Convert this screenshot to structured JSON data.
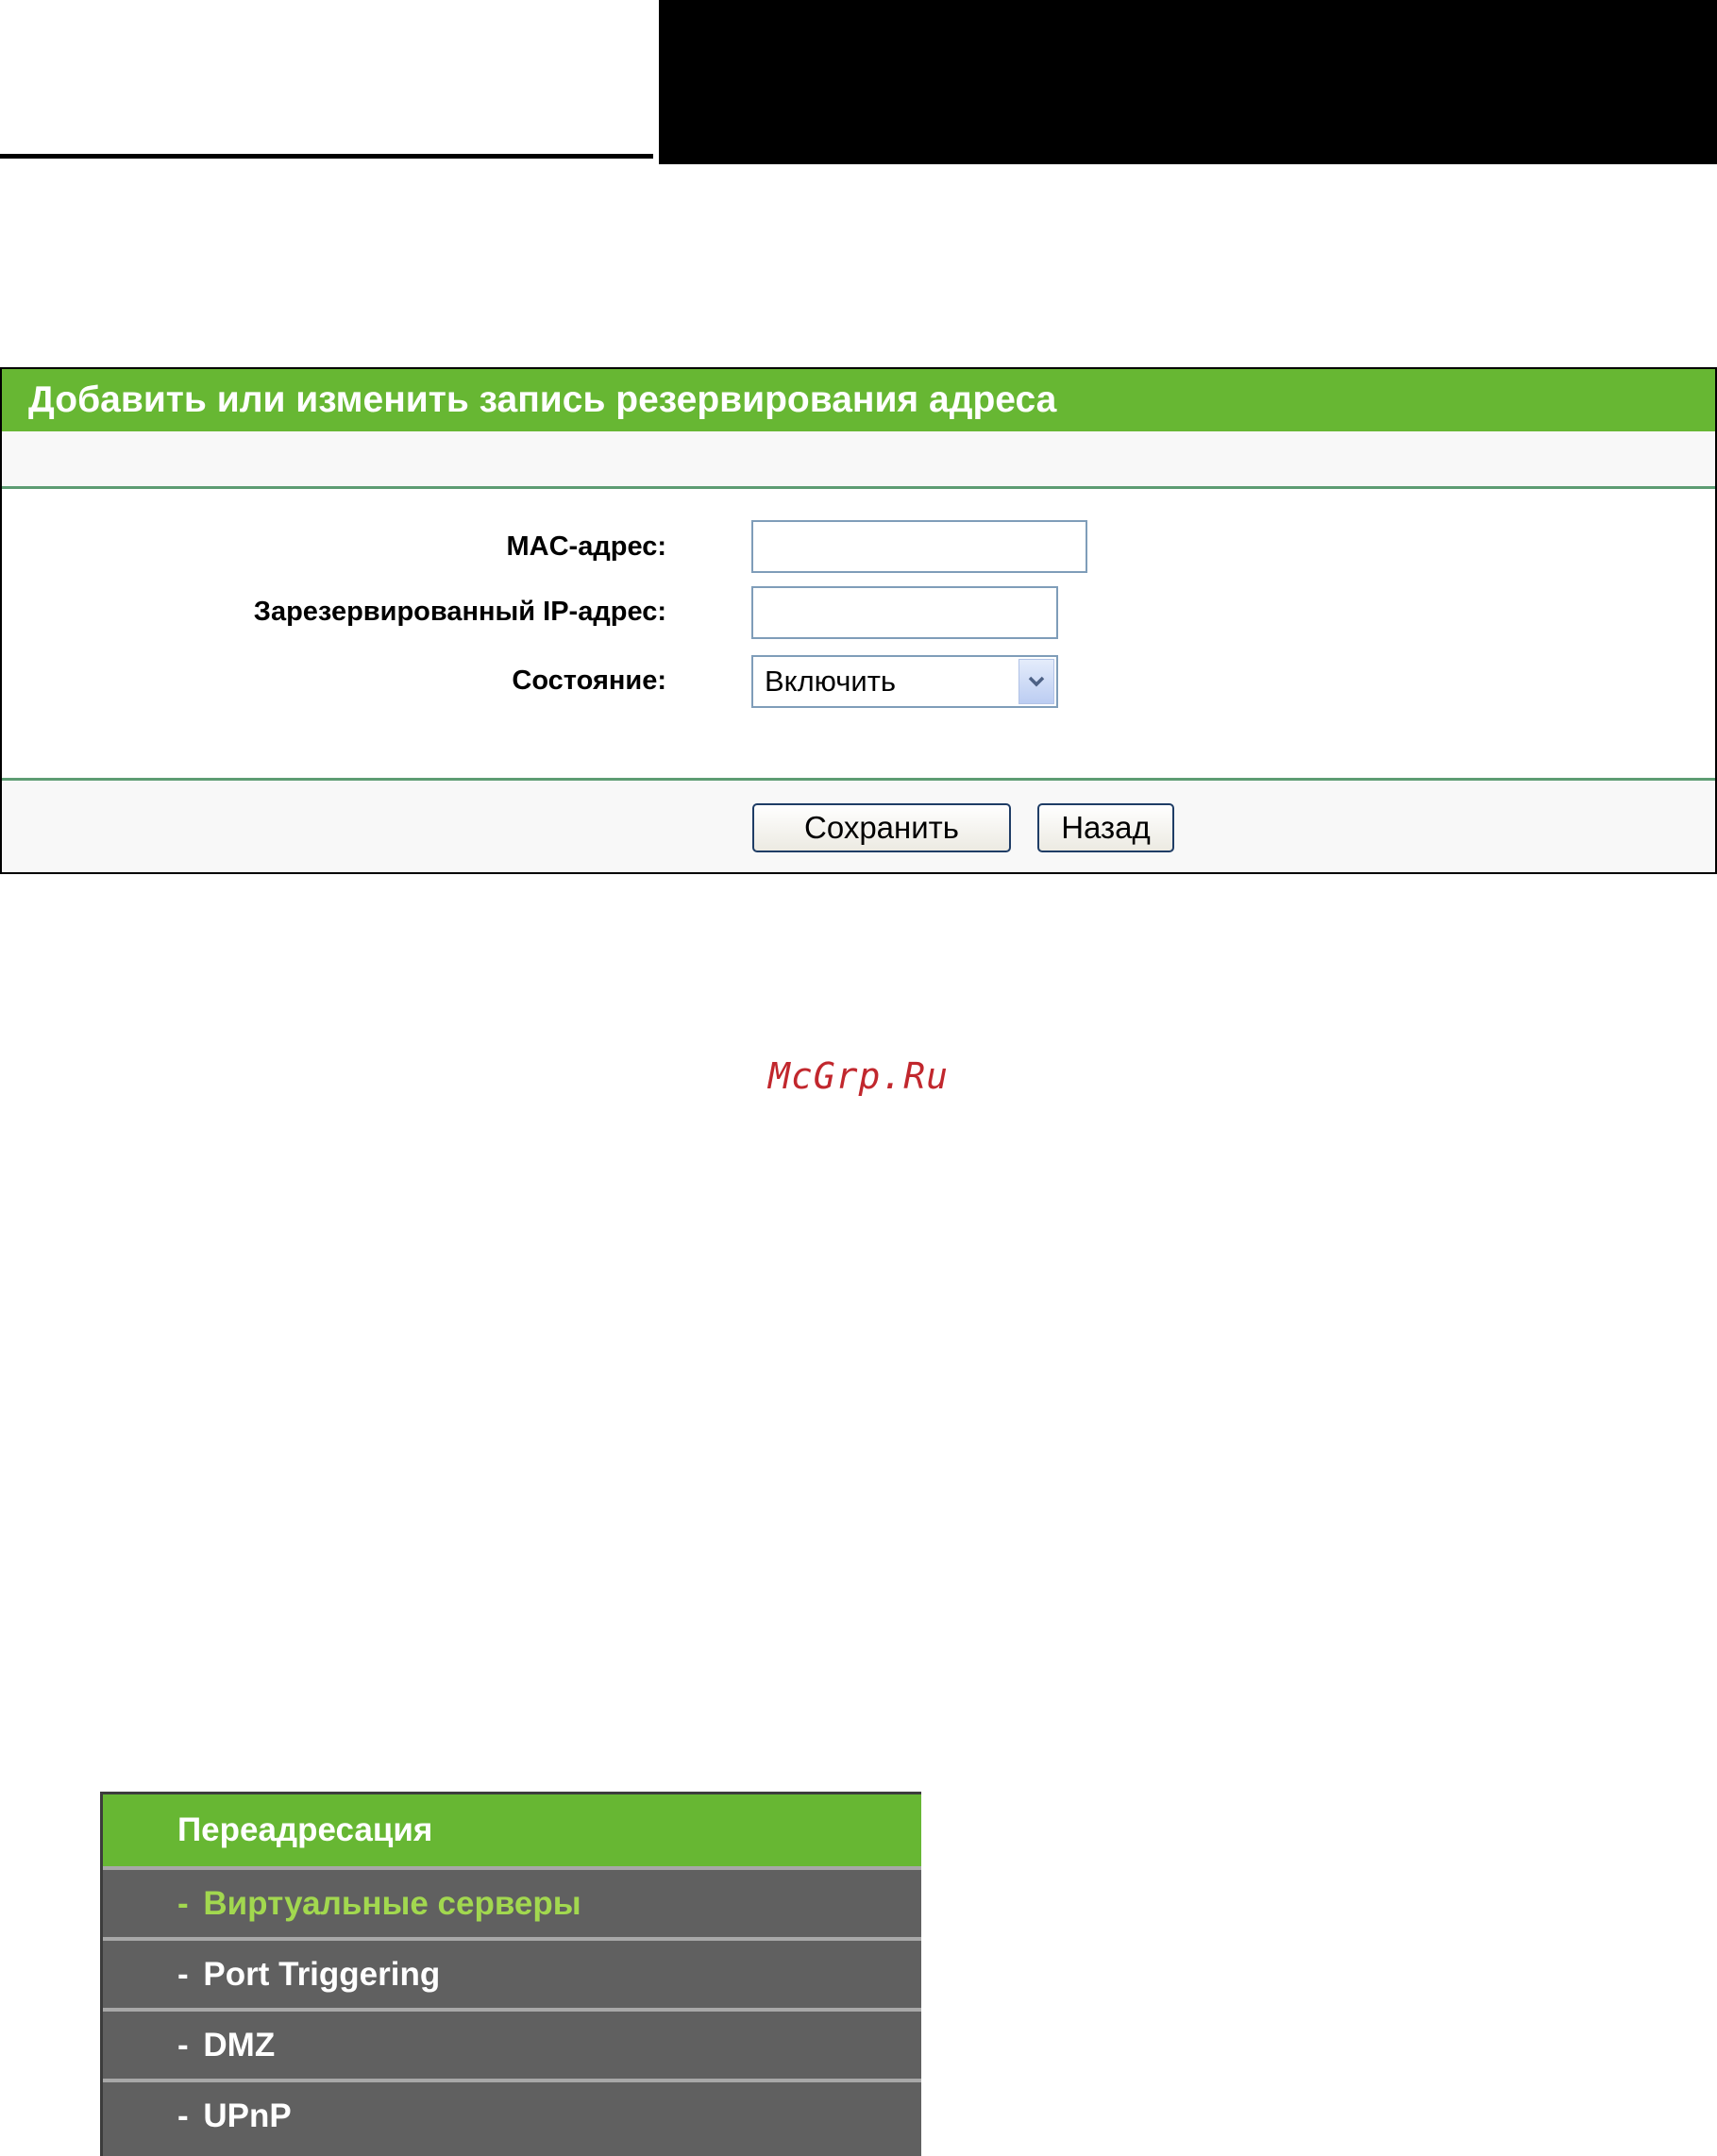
{
  "form": {
    "title": "Добавить или изменить запись резервирования адреса",
    "mac_label": "MAC-адрес:",
    "mac_value": "",
    "ip_label": "Зарезервированный IP-адрес:",
    "ip_value": "",
    "status_label": "Состояние:",
    "status_value": "Включить",
    "save_label": "Сохранить",
    "back_label": "Назад"
  },
  "watermark": "McGrp.Ru",
  "menu": {
    "head": "Переадресация",
    "items": [
      {
        "label": "Виртуальные серверы",
        "active": true
      },
      {
        "label": "Port Triggering",
        "active": false
      },
      {
        "label": "DMZ",
        "active": false
      },
      {
        "label": "UPnP",
        "active": false
      }
    ],
    "dash": "- "
  },
  "colors": {
    "accent_green": "#67b733",
    "menu_bg": "#606060",
    "active_item": "#a2d84f",
    "separator": "#5d9c73"
  }
}
